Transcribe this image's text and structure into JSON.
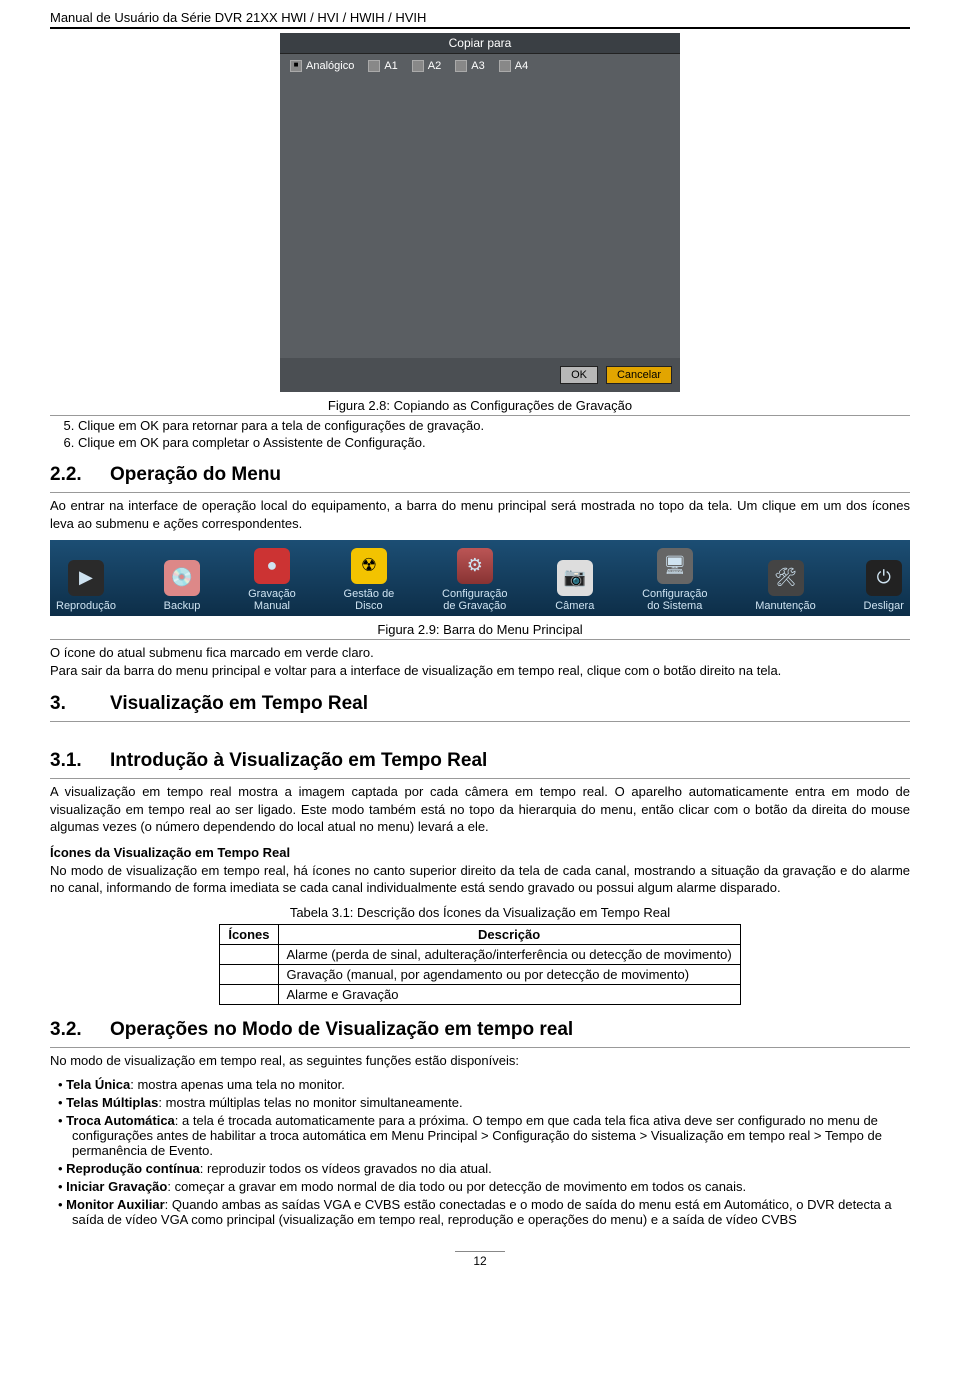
{
  "doc_header": "Manual de Usuário da Série DVR 21XX HWI / HVI / HWIH / HVIH",
  "dialog": {
    "title": "Copiar para",
    "analog_label": "Analógico",
    "channels": [
      "A1",
      "A2",
      "A3",
      "A4"
    ],
    "ok": "OK",
    "cancel": "Cancelar"
  },
  "caption_28": "Figura 2.8: Copiando as Configurações de Gravação",
  "steps": {
    "s5": "Clique em OK para retornar para a tela de configurações de gravação.",
    "s6": "Clique em OK para completar o Assistente de Configuração."
  },
  "sec22": {
    "num": "2.2.",
    "title": "Operação do Menu",
    "body": "Ao entrar na interface de operação local do equipamento, a barra do menu principal será mostrada no topo da tela. Um clique em um dos ícones leva ao submenu e ações correspondentes."
  },
  "menu": {
    "items": [
      {
        "label": "Reprodução",
        "glyph": "▶"
      },
      {
        "label": "Backup",
        "glyph": "💿"
      },
      {
        "label": "Gravação\nManual",
        "glyph": "●"
      },
      {
        "label": "Gestão de\nDisco",
        "glyph": "☢"
      },
      {
        "label": "Configuração\nde Gravação",
        "glyph": "⚙"
      },
      {
        "label": "Câmera",
        "glyph": "📷"
      },
      {
        "label": "Configuração\ndo Sistema",
        "glyph": "🖥"
      },
      {
        "label": "Manutenção",
        "glyph": "🛠"
      },
      {
        "label": "Desligar",
        "glyph": "⏻"
      }
    ]
  },
  "caption_29": "Figura 2.9: Barra do Menu Principal",
  "post_menu": {
    "l1": "O ícone do atual submenu fica marcado em verde claro.",
    "l2": "Para sair da barra do menu principal e voltar para a interface de visualização em tempo real, clique com o botão direito na tela."
  },
  "sec3": {
    "num": "3.",
    "title": "Visualização em Tempo Real"
  },
  "sec31": {
    "num": "3.1.",
    "title": "Introdução à Visualização em Tempo Real",
    "p1": "A visualização em tempo real mostra a imagem captada por cada câmera em tempo real. O aparelho automaticamente entra em modo de visualização em tempo real ao ser ligado. Este modo também está no topo da hierarquia do menu, então clicar com o botão da direita do mouse algumas vezes (o número dependendo do local atual no menu) levará a ele.",
    "subhead": "Ícones da Visualização em Tempo Real",
    "p2": "No modo de visualização em tempo real, há ícones no canto superior direito da tela de cada canal, mostrando a situação da gravação e do alarme no canal, informando de forma imediata se cada canal individualmente está sendo gravado ou possui algum alarme disparado."
  },
  "table31": {
    "caption": "Tabela 3.1: Descrição dos Ícones da Visualização em Tempo Real",
    "h1": "Ícones",
    "h2": "Descrição",
    "rows": [
      "Alarme (perda de sinal, adulteração/interferência ou detecção de movimento)",
      "Gravação (manual, por agendamento ou por detecção de movimento)",
      "Alarme e Gravação"
    ]
  },
  "sec32": {
    "num": "3.2.",
    "title": "Operações no Modo de Visualização em tempo real",
    "intro": "No modo de visualização em tempo real, as seguintes funções estão disponíveis:",
    "items": [
      {
        "b": "Tela Única",
        "t": ": mostra apenas uma tela no monitor."
      },
      {
        "b": "Telas Múltiplas",
        "t": ": mostra múltiplas telas no monitor simultaneamente."
      },
      {
        "b": "Troca Automática",
        "t": ": a tela é trocada automaticamente para a próxima. O tempo em que cada tela fica ativa deve ser configurado no menu de configurações antes de habilitar a troca automática em Menu Principal > Configuração do sistema > Visualização em tempo real > Tempo de permanência de Evento."
      },
      {
        "b": "Reprodução contínua",
        "t": ": reproduzir todos os vídeos gravados no dia atual."
      },
      {
        "b": "Iniciar Gravação",
        "t": ": começar a gravar em modo normal de dia todo ou por detecção de movimento em todos os canais."
      },
      {
        "b": "Monitor Auxiliar",
        "t": ": Quando ambas as saídas VGA e CVBS estão conectadas e o modo de saída do menu está em Automático, o DVR detecta a saída de vídeo VGA como principal (visualização em tempo real, reprodução e operações do menu) e a saída de vídeo CVBS"
      }
    ]
  },
  "page_number": "12"
}
